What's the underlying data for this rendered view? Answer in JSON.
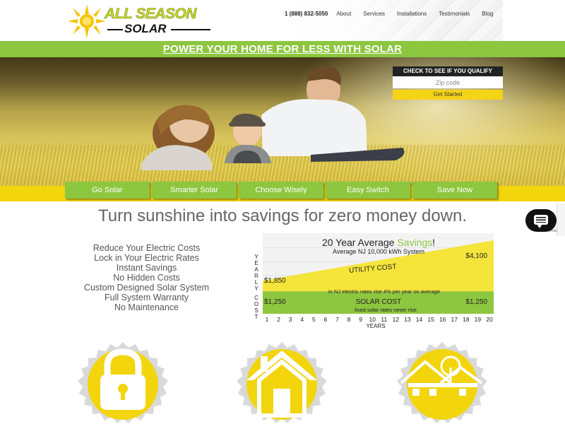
{
  "header": {
    "logo_top": "ALL SEASON",
    "logo_bottom": "SOLAR",
    "phone": "1 (888) 832-5050",
    "nav": [
      "About",
      "Services",
      "Installations",
      "Testimonials",
      "Blog"
    ]
  },
  "banner": {
    "text": "POWER YOUR HOME FOR LESS WITH SOLAR"
  },
  "qualify": {
    "title": "CHECK TO SEE IF YOU QUALIFY",
    "placeholder": "Zip code",
    "button": "Get Started"
  },
  "buttons": [
    "Go Solar",
    "Smarter Solar",
    "Choose Wisely",
    "Easy Switch",
    "Save Now"
  ],
  "tagline": "Turn sunshine into savings for zero money down.",
  "benefits": [
    "Reduce Your Electric Costs",
    "Lock in Your Electric Rates",
    "Instant Savings",
    "No Hidden Costs",
    "Custom Designed Solar System",
    "Full System Warranty",
    "No Maintenance"
  ],
  "chart_data": {
    "type": "area",
    "title_prefix": "20 Year Average ",
    "title_highlight": "Savings",
    "title_suffix": "!",
    "subtitle": "Average NJ 10,000 kWh System",
    "ylabel": "YEARLY COST",
    "xlabel": "YEARS",
    "x": [
      1,
      2,
      3,
      4,
      5,
      6,
      7,
      8,
      9,
      10,
      11,
      12,
      13,
      14,
      15,
      16,
      17,
      18,
      19,
      20
    ],
    "series": [
      {
        "name": "UTILITY COST",
        "start": 1850,
        "end": 4100,
        "start_label": "$1,850",
        "end_label": "$4,100",
        "note": "in NJ electric rates rise 4% per year on average"
      },
      {
        "name": "SOLAR COST",
        "start": 1250,
        "end": 1250,
        "start_label": "$1,250",
        "end_label": "$1,250",
        "note": "fixed solar rates never rise"
      }
    ],
    "colors": {
      "utility": "#f5e43a",
      "solar": "#8dc63f",
      "highlight": "#8dc63f"
    }
  },
  "icons": [
    "lock-icon",
    "house-icon",
    "house-tree-icon"
  ],
  "colors": {
    "green": "#8dc63f",
    "yellow": "#f2d50d"
  },
  "chat": {
    "note": "Terms"
  }
}
